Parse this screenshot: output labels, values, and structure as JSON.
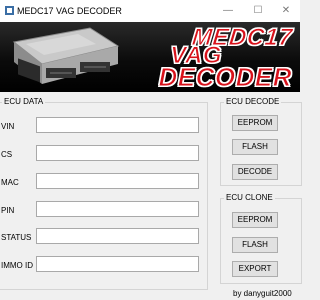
{
  "window": {
    "title": "MEDC17 VAG DECODER",
    "minimize_glyph": "—",
    "maximize_glyph": "☐",
    "close_glyph": "✕"
  },
  "banner": {
    "line1": "MEDC17",
    "line2": "VAG",
    "line3": "DECODER",
    "text_color": "#d8121b",
    "outline_color": "#ffffff"
  },
  "ecu_data": {
    "group_label": "ECU DATA",
    "fields": [
      {
        "label": "VIN",
        "value": ""
      },
      {
        "label": "CS",
        "value": ""
      },
      {
        "label": "MAC",
        "value": ""
      },
      {
        "label": "PIN",
        "value": ""
      },
      {
        "label": "STATUS",
        "value": ""
      },
      {
        "label": "IMMO ID",
        "value": ""
      }
    ]
  },
  "ecu_decode": {
    "group_label": "ECU DECODE",
    "buttons": [
      "EEPROM",
      "FLASH",
      "DECODE"
    ]
  },
  "ecu_clone": {
    "group_label": "ECU CLONE",
    "buttons": [
      "EEPROM",
      "FLASH",
      "EXPORT"
    ]
  },
  "footer": {
    "credit": "by danyguit2000"
  }
}
